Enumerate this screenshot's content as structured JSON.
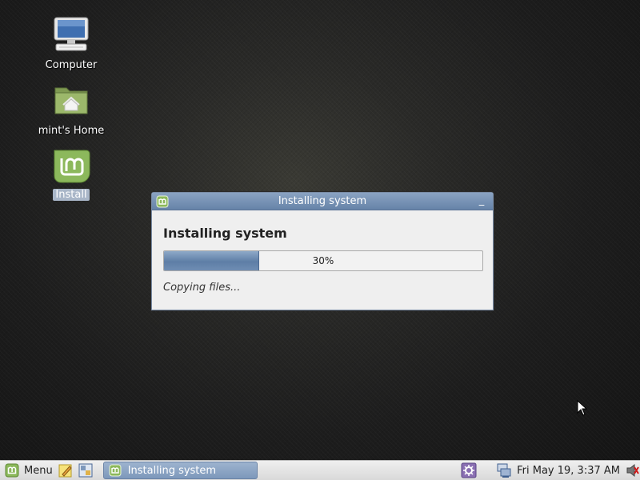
{
  "desktop": {
    "icons": [
      {
        "label": "Computer",
        "icon": "computer-icon"
      },
      {
        "label": "mint's Home",
        "icon": "home-folder-icon"
      },
      {
        "label": "Install",
        "icon": "mint-install-icon"
      }
    ]
  },
  "dialog": {
    "title": "Installing system",
    "heading": "Installing system",
    "progress_label": "30%",
    "progress_fraction": 0.3,
    "status": "Copying files...",
    "minimize_glyph": "_"
  },
  "taskbar": {
    "menu_label": "Menu",
    "launchers": [
      "notes-icon",
      "desktop-switch-icon"
    ],
    "active_task": "Installing system",
    "tray": [
      "settings-icon",
      "network-icon",
      "volume-icon"
    ],
    "clock": "Fri May 19,  3:37 AM"
  },
  "colors": {
    "accent": "#7d98bb",
    "mint_green": "#8cb85c"
  }
}
